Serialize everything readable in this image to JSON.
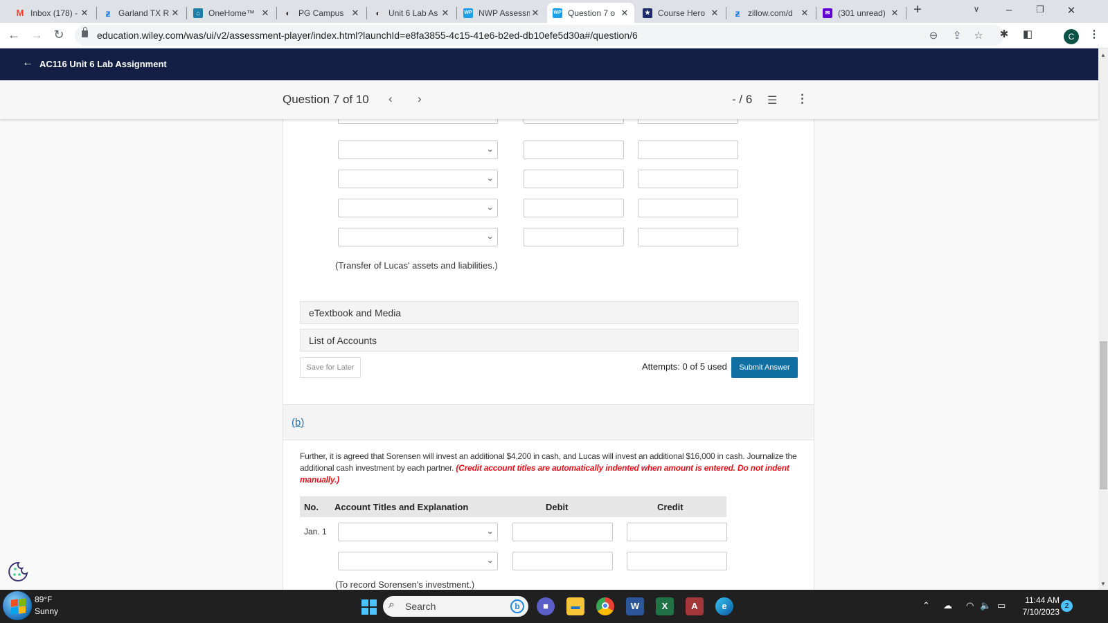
{
  "browser": {
    "tabs": [
      {
        "title": "Inbox (178) -",
        "icon": "gmail-icon",
        "active": false
      },
      {
        "title": "Garland TX R",
        "icon": "zillow-icon",
        "active": false
      },
      {
        "title": "OneHome™",
        "icon": "onehome-icon",
        "active": false
      },
      {
        "title": "PG Campus",
        "icon": "campus-icon",
        "active": false
      },
      {
        "title": "Unit 6 Lab As",
        "icon": "campus-icon",
        "active": false
      },
      {
        "title": "NWP Assessm",
        "icon": "wileyplus-icon",
        "active": false
      },
      {
        "title": "Question 7 o",
        "icon": "wileyplus-icon",
        "active": true
      },
      {
        "title": "Course Hero",
        "icon": "coursehero-icon",
        "active": false
      },
      {
        "title": "zillow.com/d",
        "icon": "zillow-icon",
        "active": false
      },
      {
        "title": "(301 unread)",
        "icon": "yahoo-mail-icon",
        "active": false
      }
    ],
    "new_tab": "+",
    "url": "education.wiley.com/was/ui/v2/assessment-player/index.html?launchId=e8fa3855-4c15-41e6-b2ed-db10efe5d30a#/question/6",
    "profile_initial": "C"
  },
  "app": {
    "assignment_title": "AC116 Unit 6 Lab Assignment",
    "question_label": "Question 7 of 10",
    "score": "- / 6"
  },
  "part_a": {
    "rows": 5,
    "explanation": "(Transfer of Lucas' assets and liabilities.)",
    "accordions": [
      "eTextbook and Media",
      "List of Accounts"
    ],
    "save_label": "Save for Later",
    "attempts": "Attempts: 0 of 5 used",
    "submit_label": "Submit Answer"
  },
  "part_b": {
    "label": "(b)",
    "instructions": "Further, it is agreed that Sorensen will invest an additional $4,200 in cash, and Lucas will invest an additional $16,000 in cash. Journalize the additional cash investment by each partner.",
    "warning": "(Credit account titles are automatically indented when amount is entered. Do not indent manually.)",
    "table_headers": {
      "no": "No.",
      "account": "Account Titles and Explanation",
      "debit": "Debit",
      "credit": "Credit"
    },
    "date": "Jan. 1",
    "explanation": "(To record Sorensen's investment.)"
  },
  "taskbar": {
    "weather_temp": "89°F",
    "weather_desc": "Sunny",
    "search_label": "Search",
    "time": "11:44 AM",
    "date": "7/10/2023",
    "notifications": "2"
  }
}
